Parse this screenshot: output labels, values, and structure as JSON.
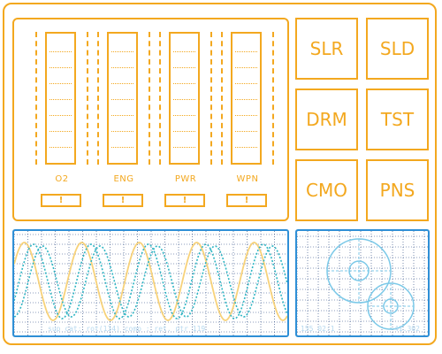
{
  "gauges": [
    {
      "label": "O2",
      "alert": "!"
    },
    {
      "label": "ENG",
      "alert": "!"
    },
    {
      "label": "PWR",
      "alert": "!"
    },
    {
      "label": "WPN",
      "alert": "!"
    }
  ],
  "buttons": [
    {
      "label": "SLR"
    },
    {
      "label": "SLD"
    },
    {
      "label": "DRM"
    },
    {
      "label": "TST"
    },
    {
      "label": "CMO"
    },
    {
      "label": "PNS"
    }
  ],
  "oscilloscope": {
    "readout": "sup cat: rot(134) comp : ret. ptr 119"
  },
  "radar": {
    "readout_left": "155 02:1",
    "readout_right": "41.302"
  },
  "colors": {
    "accent": "#f3a81f",
    "scope_frame": "#2e8fd6",
    "wave_teal": "#2fb5c4",
    "wave_yellow": "#f7d27a",
    "grid": "#1f3f7a"
  }
}
